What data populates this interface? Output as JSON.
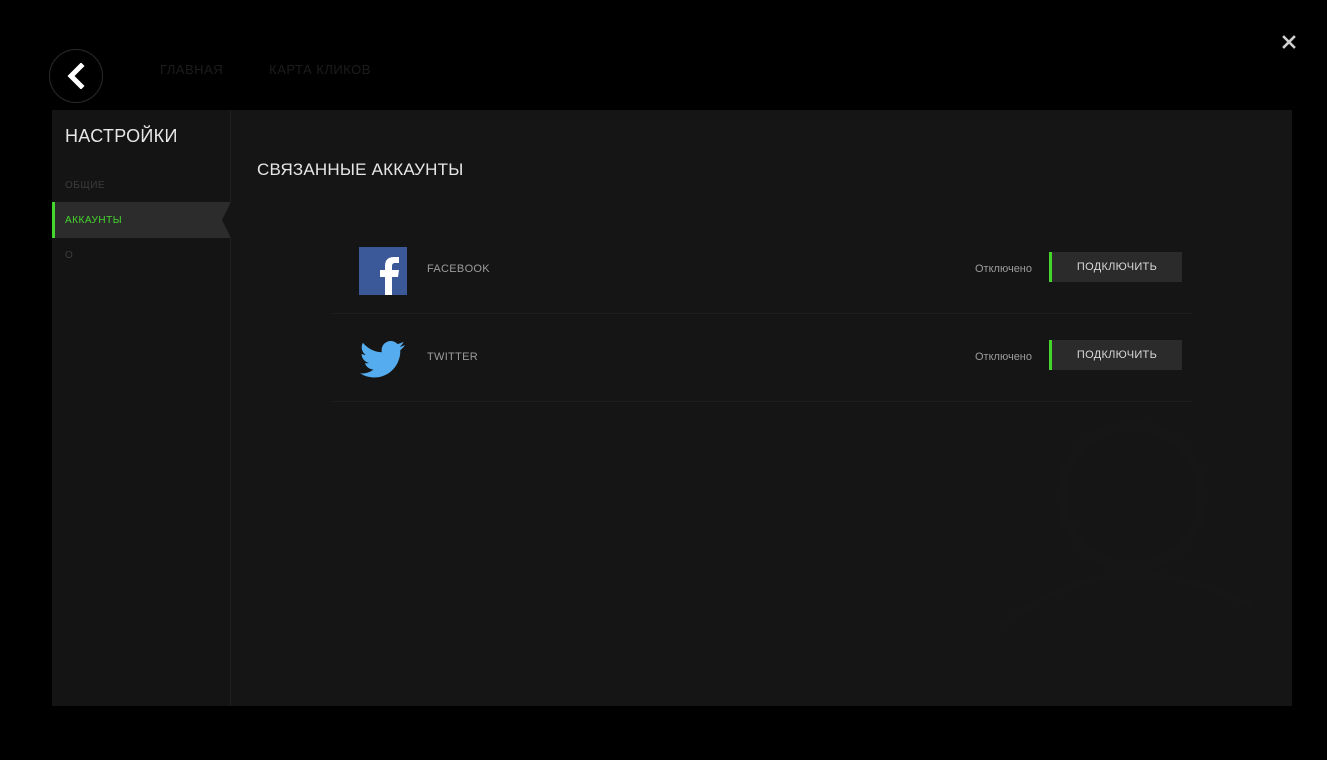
{
  "header": {
    "nav": [
      "ГЛАВНАЯ",
      "КАРТА КЛИКОВ"
    ]
  },
  "sidebar": {
    "title": "НАСТРОЙКИ",
    "items": [
      {
        "label": "ОБЩИЕ"
      },
      {
        "label": "АККАУНТЫ",
        "active": true
      },
      {
        "label": "О"
      }
    ]
  },
  "main": {
    "title": "СВЯЗАННЫЕ АККАУНТЫ",
    "accounts": [
      {
        "name": "FACEBOOK",
        "status": "Отключено",
        "button": "ПОДКЛЮЧИТЬ",
        "icon": "facebook-logo"
      },
      {
        "name": "TWITTER",
        "status": "Отключено",
        "button": "ПОДКЛЮЧИТЬ",
        "icon": "twitter-logo"
      }
    ]
  },
  "colors": {
    "accent": "#44d62c",
    "background": "#000000",
    "panel": "#151515",
    "facebook": "#3b5998",
    "twitter": "#55acee"
  }
}
